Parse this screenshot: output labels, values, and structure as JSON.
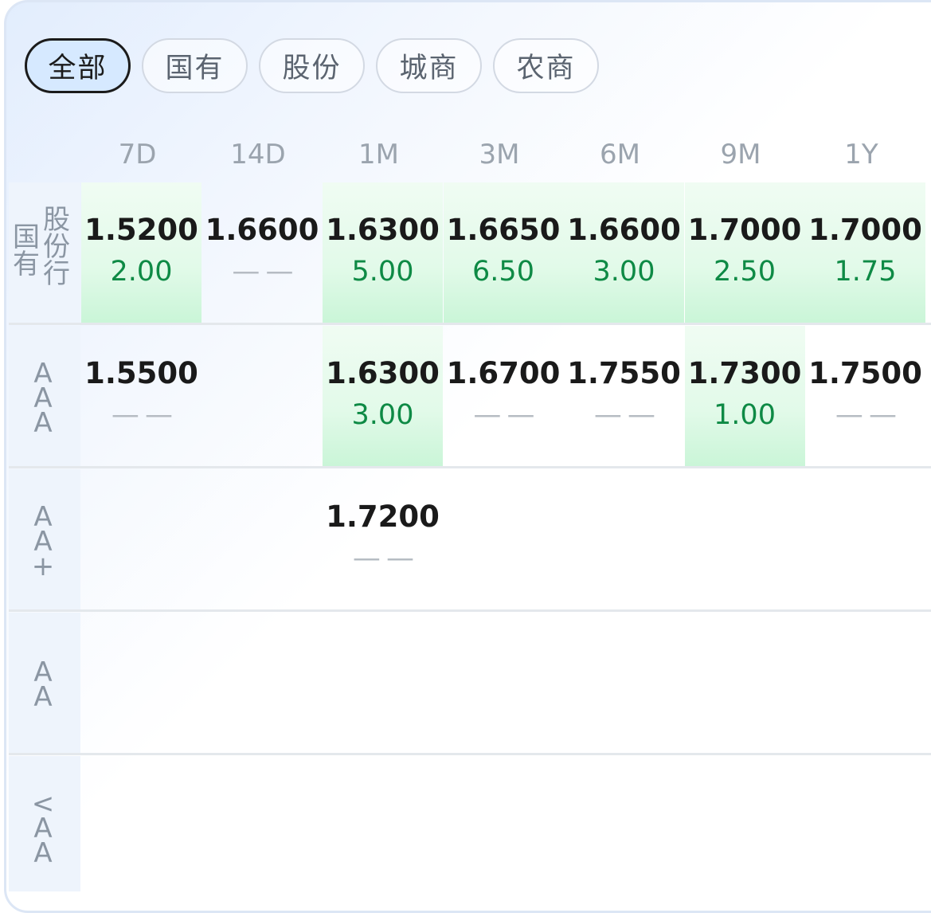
{
  "filters": {
    "items": [
      "全部",
      "国有",
      "股份",
      "城商",
      "农商"
    ],
    "active_index": 0
  },
  "tenors": [
    "7D",
    "14D",
    "1M",
    "3M",
    "6M",
    "9M",
    "1Y"
  ],
  "rows": [
    {
      "label_left": "国有",
      "label_right": "股份行",
      "cells": [
        {
          "rate": "1.5200",
          "vol": "2.00",
          "highlight": true
        },
        {
          "rate": "1.6600",
          "vol": "--",
          "highlight": false
        },
        {
          "rate": "1.6300",
          "vol": "5.00",
          "highlight": true
        },
        {
          "rate": "1.6650",
          "vol": "6.50",
          "highlight": true
        },
        {
          "rate": "1.6600",
          "vol": "3.00",
          "highlight": true
        },
        {
          "rate": "1.7000",
          "vol": "2.50",
          "highlight": true
        },
        {
          "rate": "1.7000",
          "vol": "1.75",
          "highlight": true
        }
      ]
    },
    {
      "label": "AAA",
      "cells": [
        {
          "rate": "1.5500",
          "vol": "--",
          "highlight": false
        },
        {
          "rate": "",
          "vol": "",
          "highlight": false
        },
        {
          "rate": "1.6300",
          "vol": "3.00",
          "highlight": true
        },
        {
          "rate": "1.6700",
          "vol": "--",
          "highlight": false
        },
        {
          "rate": "1.7550",
          "vol": "--",
          "highlight": false
        },
        {
          "rate": "1.7300",
          "vol": "1.00",
          "highlight": true
        },
        {
          "rate": "1.7500",
          "vol": "--",
          "highlight": false
        }
      ]
    },
    {
      "label": "AA+",
      "cells": [
        {
          "rate": "",
          "vol": "",
          "highlight": false
        },
        {
          "rate": "",
          "vol": "",
          "highlight": false
        },
        {
          "rate": "1.7200",
          "vol": "--",
          "highlight": false
        },
        {
          "rate": "",
          "vol": "",
          "highlight": false
        },
        {
          "rate": "",
          "vol": "",
          "highlight": false
        },
        {
          "rate": "",
          "vol": "",
          "highlight": false
        },
        {
          "rate": "",
          "vol": "",
          "highlight": false
        }
      ]
    },
    {
      "label": "AA",
      "cells": [
        {
          "rate": "",
          "vol": "",
          "highlight": false
        },
        {
          "rate": "",
          "vol": "",
          "highlight": false
        },
        {
          "rate": "",
          "vol": "",
          "highlight": false
        },
        {
          "rate": "",
          "vol": "",
          "highlight": false
        },
        {
          "rate": "",
          "vol": "",
          "highlight": false
        },
        {
          "rate": "",
          "vol": "",
          "highlight": false
        },
        {
          "rate": "",
          "vol": "",
          "highlight": false
        }
      ]
    },
    {
      "label": "<AA",
      "cells": [
        {
          "rate": "",
          "vol": "",
          "highlight": false
        },
        {
          "rate": "",
          "vol": "",
          "highlight": false
        },
        {
          "rate": "",
          "vol": "",
          "highlight": false
        },
        {
          "rate": "",
          "vol": "",
          "highlight": false
        },
        {
          "rate": "",
          "vol": "",
          "highlight": false
        },
        {
          "rate": "",
          "vol": "",
          "highlight": false
        },
        {
          "rate": "",
          "vol": "",
          "highlight": false
        }
      ]
    }
  ]
}
